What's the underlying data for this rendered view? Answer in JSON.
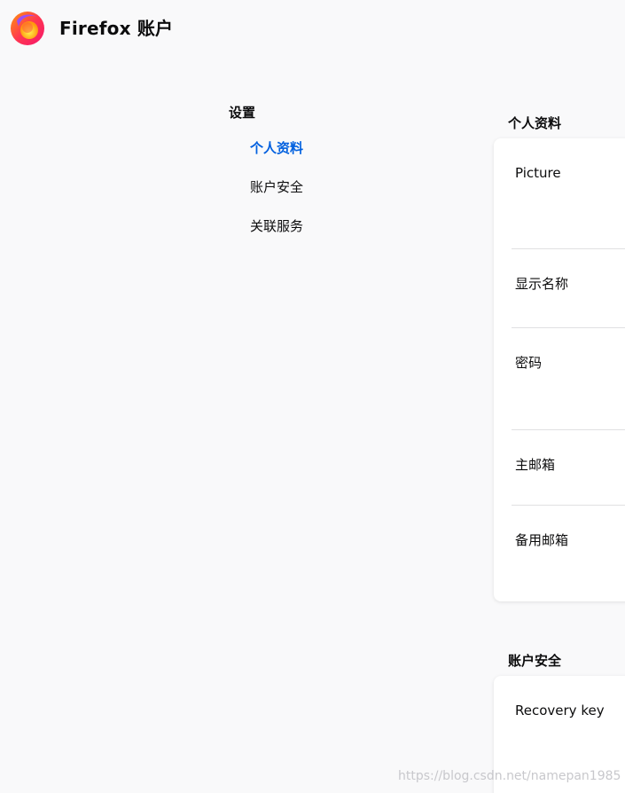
{
  "header": {
    "title": "Firefox 账户",
    "logo_icon": "firefox-logo-icon"
  },
  "nav": {
    "heading": "设置",
    "items": [
      {
        "label": "个人资料",
        "active": true
      },
      {
        "label": "账户安全",
        "active": false
      },
      {
        "label": "关联服务",
        "active": false
      }
    ]
  },
  "profile_section": {
    "heading": "个人资料",
    "rows": [
      {
        "label": "Picture"
      },
      {
        "label": "显示名称"
      },
      {
        "label": "密码"
      },
      {
        "label": "主邮箱"
      },
      {
        "label": "备用邮箱"
      }
    ]
  },
  "security_section": {
    "heading": "账户安全",
    "rows": [
      {
        "label": "Recovery key"
      }
    ]
  },
  "watermark": "https://blog.csdn.net/namepan1985",
  "colors": {
    "background": "#f9f9fa",
    "active_link": "#0060df",
    "text": "#0c0c0d",
    "card": "#ffffff"
  }
}
